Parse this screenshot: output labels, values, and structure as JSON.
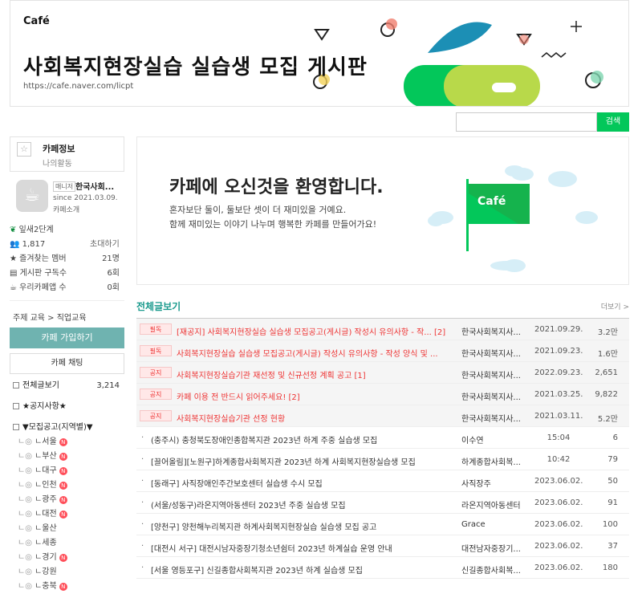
{
  "banner": {
    "logo": "Café",
    "title": "사회복지현장실습 실습생 모집 게시판",
    "url": "https://cafe.naver.com/licpt"
  },
  "search": {
    "button": "검색",
    "placeholder": ""
  },
  "sidebar": {
    "cafe_info_tab": "카페정보",
    "my_activity_tab": "나의활동",
    "manager_badge": "매니저",
    "manager_name": "한국사회...",
    "since": "since 2021.03.09.",
    "cafe_intro": "카페소개",
    "level": "잎새2단계",
    "members": "1,817",
    "invite": "초대하기",
    "stats": [
      {
        "label": "즐겨찾는 멤버",
        "value": "21명"
      },
      {
        "label": "게시판 구독수",
        "value": "6회"
      },
      {
        "label": "우리카페앱 수",
        "value": "0회"
      }
    ],
    "topic": "주제 교육 > 직업교육",
    "join_button": "카페 가입하기",
    "chat_button": "카페 채팅",
    "menu_all": "전체글보기",
    "menu_all_count": "3,214",
    "menu_notice": "★공지사항★",
    "menu_recruit": "▼모집공고(지역별)▼",
    "regions": [
      {
        "label": "ㄴ서울",
        "new": true
      },
      {
        "label": "ㄴ부산",
        "new": true
      },
      {
        "label": "ㄴ대구",
        "new": true
      },
      {
        "label": "ㄴ인천",
        "new": true
      },
      {
        "label": "ㄴ광주",
        "new": true
      },
      {
        "label": "ㄴ대전",
        "new": true
      },
      {
        "label": "ㄴ울산",
        "new": false
      },
      {
        "label": "ㄴ세종",
        "new": false
      },
      {
        "label": "ㄴ경기",
        "new": true
      },
      {
        "label": "ㄴ강원",
        "new": false
      },
      {
        "label": "ㄴ충북",
        "new": true
      }
    ],
    "new_badge": "N"
  },
  "welcome": {
    "title": "카페에 오신것을 환영합니다.",
    "line1": "혼자보단 둘이, 둘보단 셋이 더 재미있을 거예요.",
    "line2": "함께 재미있는 이야기 나누며 행복한 카페를 만들어가요!",
    "flag_logo": "Café"
  },
  "list": {
    "title": "전체글보기",
    "more": "더보기 >",
    "rows": [
      {
        "tag": "필독",
        "title": "[재공지] 사회복지현장실습 실습생 모집공고(게시글) 작성시 유의사항 - 작...  [2]",
        "author": "한국사회복지사...",
        "date": "2021.09.29.",
        "views": "3.2만"
      },
      {
        "tag": "필독",
        "title": "사회복지현장실습 실습생 모집공고(게시글) 작성시 유의사항 - 작성 양식 및 ...",
        "author": "한국사회복지사...",
        "date": "2021.09.23.",
        "views": "1.6만"
      },
      {
        "tag": "공지",
        "title": "사회복지현장실습기관 재선정 및 신규선정 계획 공고 [1]",
        "author": "한국사회복지사...",
        "date": "2022.09.23.",
        "views": "2,651"
      },
      {
        "tag": "공지",
        "title": "카페 이용 전 반드시 읽어주세요! [2]",
        "author": "한국사회복지사...",
        "date": "2021.03.25.",
        "views": "9,822"
      },
      {
        "tag": "공지",
        "title": "사회복지현장실습기관 선정 현황",
        "author": "한국사회복지사...",
        "date": "2021.03.11.",
        "views": "5.2만"
      },
      {
        "title": "(충주시) 충청북도장애인종합복지관 2023년 하계 주중 실습생 모집",
        "author": "이수연",
        "date": "15:04",
        "views": "6"
      },
      {
        "title": "[끌어올림][노원구]하계종합사회복지관 2023년 하계 사회복지현장실습생 모집",
        "author": "하계종합사회복...",
        "date": "10:42",
        "views": "79"
      },
      {
        "title": "[동래구] 사직장애인주간보호센터 실습생 수시 모집",
        "author": "사직장주",
        "date": "2023.06.02.",
        "views": "50"
      },
      {
        "title": "(서울/성동구)라온지역아동센터 2023년 주중 실습생 모집",
        "author": "라온지역아동센터",
        "date": "2023.06.02.",
        "views": "91"
      },
      {
        "title": "[양천구] 양천해누리복지관 하계사회복지현장실습 실습생 모집 공고",
        "author": "Grace",
        "date": "2023.06.02.",
        "views": "100"
      },
      {
        "title": "[대전시 서구] 대전시남자중장기청소년쉼터 2023년 하계실습 운영 안내",
        "author": "대전남자중장기...",
        "date": "2023.06.02.",
        "views": "37"
      },
      {
        "title": "[서울 영등포구] 신길종합사회복지관 2023년 하계 실습생 모집",
        "author": "신길종합사회복...",
        "date": "2023.06.02.",
        "views": "180"
      }
    ]
  },
  "colors": {
    "brand_green": "#03c75a",
    "teal": "#1a9a8d",
    "join": "#6fb3b0",
    "notice_red": "#e33333"
  }
}
